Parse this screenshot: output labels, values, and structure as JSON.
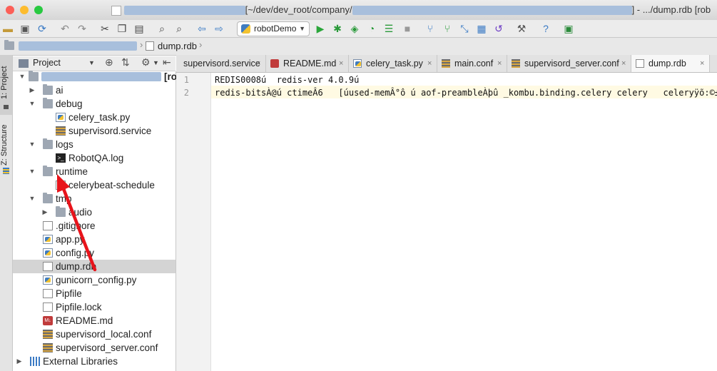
{
  "window": {
    "title_path": "[~/dev/dev_root/company/",
    "title_file": "] - .../dump.rdb [rob"
  },
  "toolbar": {
    "run_config": "robotDemo"
  },
  "navbar": {
    "file": "dump.rdb"
  },
  "side_tools": {
    "project_label": "1: Project",
    "structure_label": "Z: Structure"
  },
  "project_panel": {
    "title": "Project",
    "root_suffix": "[ro"
  },
  "tree": [
    {
      "label": "ai",
      "type": "folder",
      "depth": 1,
      "expanded": false
    },
    {
      "label": "debug",
      "type": "folder",
      "depth": 1,
      "expanded": true
    },
    {
      "label": "celery_task.py",
      "type": "python",
      "depth": 2
    },
    {
      "label": "supervisord.service",
      "type": "config",
      "depth": 2
    },
    {
      "label": "logs",
      "type": "folder",
      "depth": 1,
      "expanded": true
    },
    {
      "label": "RobotQA.log",
      "type": "log",
      "depth": 2
    },
    {
      "label": "runtime",
      "type": "folder",
      "depth": 1,
      "expanded": true
    },
    {
      "label": "celerybeat-schedule",
      "type": "file",
      "depth": 2
    },
    {
      "label": "tmp",
      "type": "folder",
      "depth": 1,
      "expanded": true
    },
    {
      "label": "audio",
      "type": "folder",
      "depth": 2,
      "expanded": false
    },
    {
      "label": ".gitignore",
      "type": "file",
      "depth": 1
    },
    {
      "label": "app.py",
      "type": "python",
      "depth": 1
    },
    {
      "label": "config.py",
      "type": "python",
      "depth": 1
    },
    {
      "label": "dump.rdb",
      "type": "file",
      "depth": 1,
      "selected": true
    },
    {
      "label": "gunicorn_config.py",
      "type": "python",
      "depth": 1
    },
    {
      "label": "Pipfile",
      "type": "file",
      "depth": 1
    },
    {
      "label": "Pipfile.lock",
      "type": "file",
      "depth": 1
    },
    {
      "label": "README.md",
      "type": "markdown",
      "depth": 1
    },
    {
      "label": "supervisord_local.conf",
      "type": "config",
      "depth": 1
    },
    {
      "label": "supervisord_server.conf",
      "type": "config",
      "depth": 1
    },
    {
      "label": "External Libraries",
      "type": "library",
      "depth": 0,
      "expanded": false
    }
  ],
  "tabs": [
    {
      "label": "supervisord.service",
      "type": "config"
    },
    {
      "label": "README.md",
      "type": "markdown"
    },
    {
      "label": "celery_task.py",
      "type": "python"
    },
    {
      "label": "main.conf",
      "type": "config"
    },
    {
      "label": "supervisord_server.conf",
      "type": "config"
    },
    {
      "label": "dump.rdb",
      "type": "file",
      "active": true
    }
  ],
  "editor": {
    "line_numbers": [
      "1",
      "2"
    ],
    "lines": [
      "REDIS0008ú  redis-ver 4.0.9ú",
      "redis-bitsÀ@ú ctimeÂ6   [úused-memÂ°ô \u0001ú aof-preambleÀ\u0000þ\u0000û\u0001\u0000 _kombu.binding.celery celery   celeryÿõ:©± l"
    ]
  },
  "annotation": {
    "color": "#e8141b"
  }
}
